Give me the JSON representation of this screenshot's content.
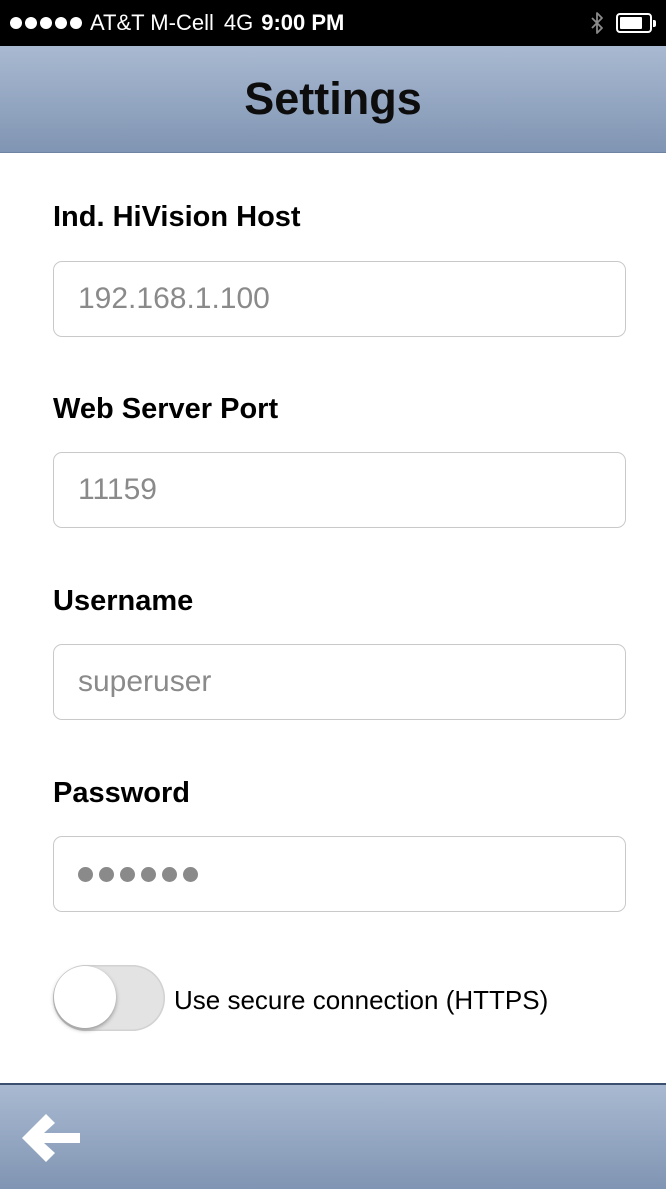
{
  "status_bar": {
    "carrier": "AT&T M-Cell",
    "network": "4G",
    "time": "9:00 PM",
    "battery_level": 0.8
  },
  "header": {
    "title": "Settings"
  },
  "form": {
    "host": {
      "label": "Ind. HiVision Host",
      "value": "192.168.1.100"
    },
    "port": {
      "label": "Web Server Port",
      "value": "11159"
    },
    "username": {
      "label": "Username",
      "value": "superuser"
    },
    "password": {
      "label": "Password",
      "masked_length": 6
    },
    "secure": {
      "label": "Use secure connection (HTTPS)",
      "enabled": false
    }
  },
  "footer": {
    "back_icon": "back-arrow-icon"
  },
  "colors": {
    "bar_top": "#a9b9d1",
    "bar_bottom": "#8095b3",
    "input_border": "#c9c9c9",
    "input_text": "#8a8a8a"
  }
}
